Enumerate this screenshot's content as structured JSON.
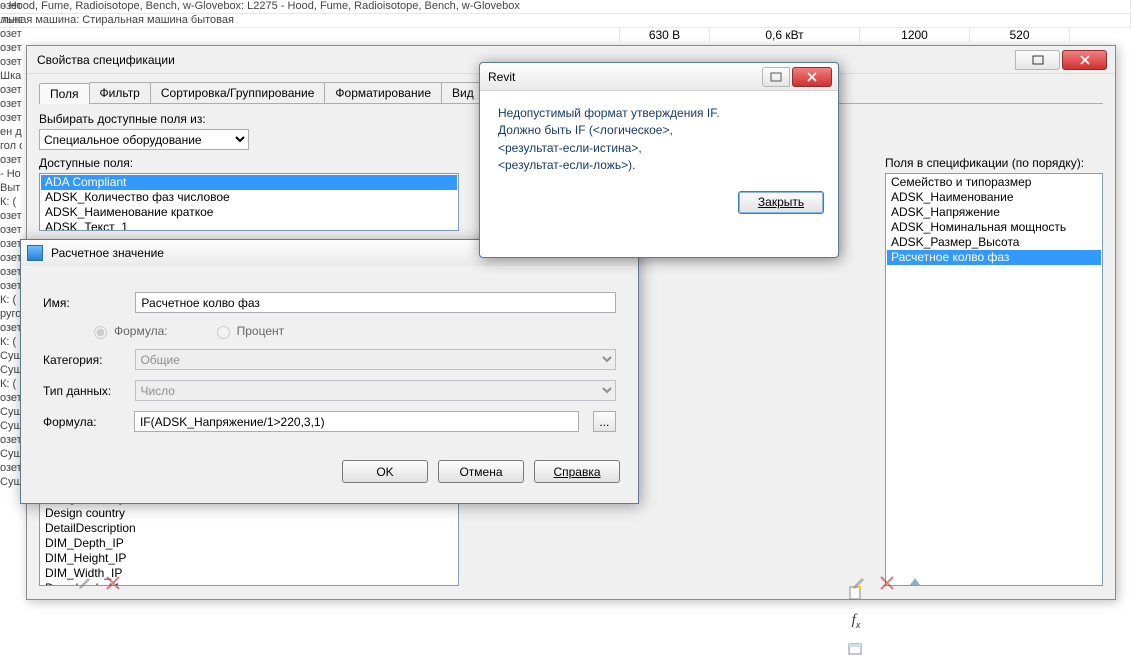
{
  "background": {
    "row1": "- Hood, Fume, Radioisotope, Bench, w-Glovebox: L2275 - Hood, Fume, Radioisotope, Bench, w-Glovebox",
    "row2": "льная машина: Стиральная машина бытовая",
    "row3_c1": "630 В",
    "row3_c2": "0,6 кВт",
    "row3_c3": "1200",
    "row3_c4": "520",
    "left_items": [
      "озет",
      "льна",
      "озет",
      "озет",
      "озет",
      "Шка",
      "озет",
      "озет",
      "озет",
      "ен д",
      "гол о",
      "озет",
      "- Но",
      "Выт",
      "К: (",
      "озет",
      "озет",
      "озет",
      "озет",
      "озет",
      "озет",
      "К: (",
      "руго",
      "озет",
      "К: (",
      "Сущ",
      "Сущ",
      "К: (",
      "озет",
      "Сущ",
      "Сущ",
      "озет",
      "Сущ",
      "озет",
      "Сущ"
    ]
  },
  "specWin": {
    "title": "Свойства спецификации",
    "tabs": [
      "Поля",
      "Фильтр",
      "Сортировка/Группирование",
      "Форматирование",
      "Вид"
    ],
    "available_from_label": "Выбирать доступные поля из:",
    "available_from_value": "Специальное оборудование",
    "available_label": "Доступные поля:",
    "available_items": [
      "ADA Compliant",
      "ADSK_Количество фаз числовое",
      "ADSK_Наименование краткое",
      "ADSK_Текст_1"
    ],
    "available_below": [
      "Design country",
      "Design country",
      "DetailDescription",
      "DIM_Depth_IP",
      "DIM_Height_IP",
      "DIM_Width_IP",
      "Downloaded from"
    ],
    "scheduled_label": "Поля в спецификации (по порядку):",
    "scheduled_items": [
      "Семейство и типоразмер",
      "ADSK_Наименование",
      "ADSK_Напряжение",
      "ADSK_Номинальная мощность",
      "ADSK_Размер_Высота",
      "Расчетное колво фаз"
    ],
    "icons": {
      "add": "add-param-icon",
      "fx": "formula-icon",
      "sheet": "sheet-icon"
    }
  },
  "calcWin": {
    "title": "Расчетное значение",
    "labels": {
      "name": "Имя:",
      "formula_radio": "Формула:",
      "percent_radio": "Процент",
      "category": "Категория:",
      "datatype": "Тип данных:",
      "formula": "Формула:"
    },
    "values": {
      "name": "Расчетное колво фаз",
      "category": "Общие",
      "datatype": "Число",
      "formula": "IF(ADSK_Напряжение/1>220,3,1)"
    },
    "buttons": {
      "ok": "OK",
      "cancel": "Отмена",
      "help": "Справка",
      "browse": "..."
    }
  },
  "msgWin": {
    "title": "Revit",
    "lines": [
      "Недопустимый формат утверждения IF.",
      "Должно быть IF (<логическое>,",
      "<результат-если-истина>,",
      "<результат-если-ложь>)."
    ],
    "close_btn": "Закрыть"
  }
}
